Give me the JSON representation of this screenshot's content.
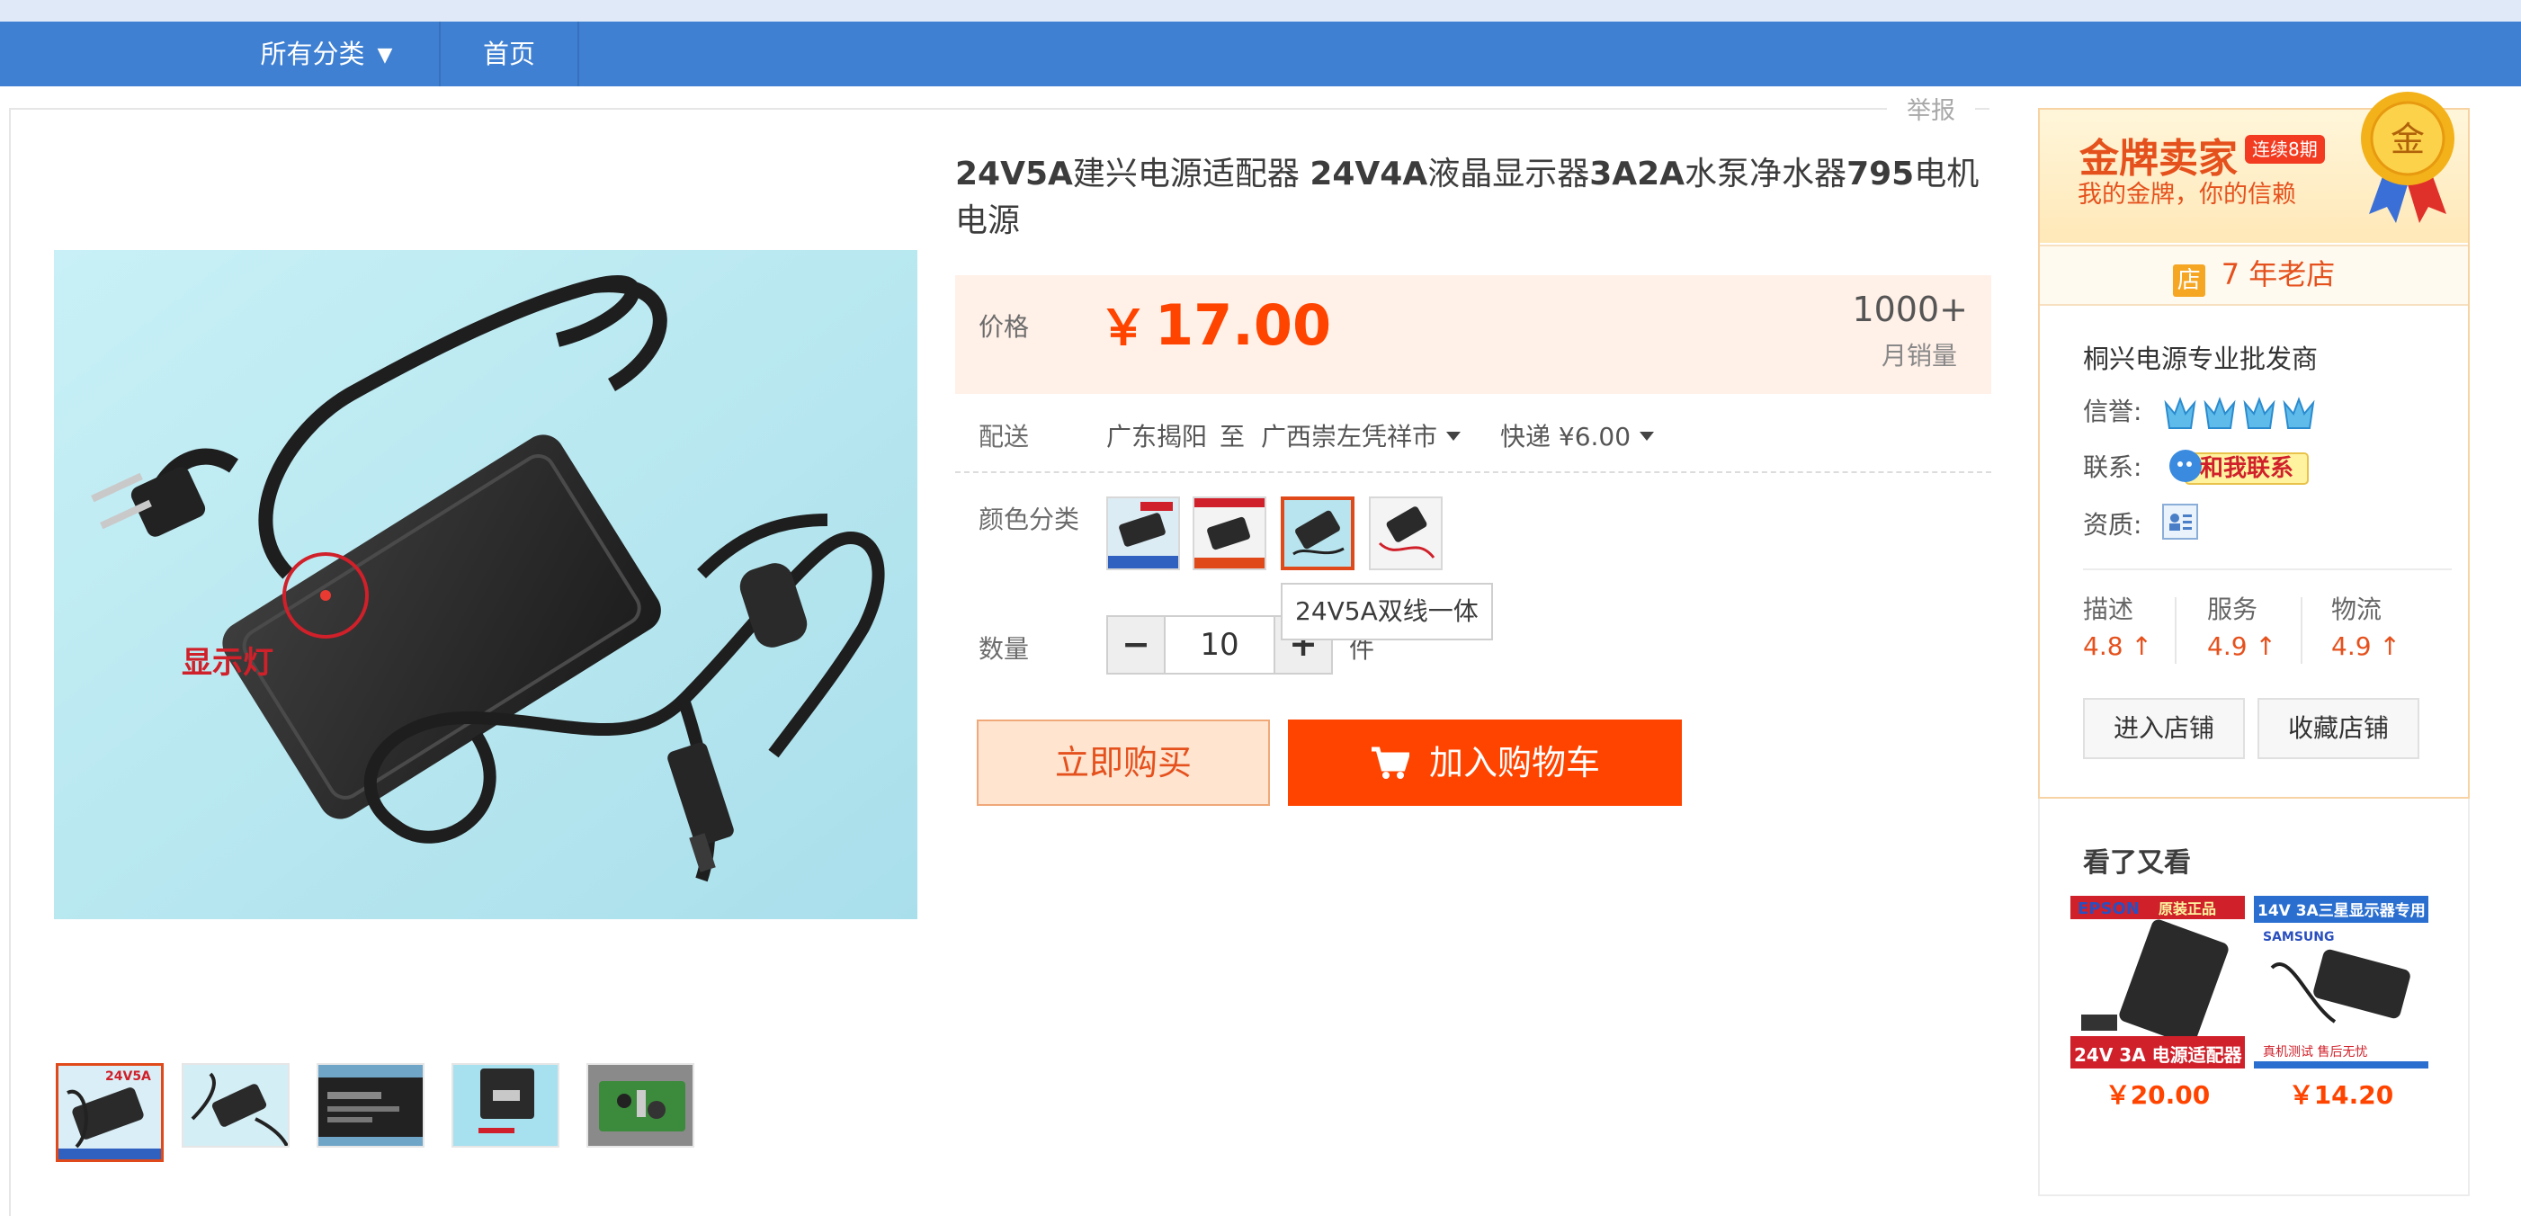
{
  "nav": {
    "all_categories": "所有分类",
    "home": "首页"
  },
  "report_label": "举报",
  "product": {
    "title_parts": [
      "24V5A",
      "建兴电源适配器 ",
      "24V4A",
      "液晶显示器",
      "3A2A",
      "水泵净水器",
      "795",
      "电机电源"
    ],
    "price_label": "价格",
    "price_symbol": "￥",
    "price": "17.00",
    "sales_count": "1000+",
    "sales_label": "月销量",
    "delivery_label": "配送",
    "delivery_from": "广东揭阳",
    "delivery_to_word": "至",
    "delivery_to": "广西崇左凭祥市",
    "shipping": "快递 ¥6.00",
    "color_label": "颜色分类",
    "thumb_label_1": "24V5A",
    "image_annotation": "显示灯",
    "sku_tooltip": "24V5A双线一体",
    "quantity_label": "数量",
    "quantity": "10",
    "quantity_unit": "件",
    "buy_now": "立即购买",
    "add_to_cart": "加入购物车"
  },
  "shop": {
    "gold_title": "金牌卖家",
    "gold_badge": "连续8期",
    "gold_sub": "我的金牌，你的信赖",
    "medal_char": "金",
    "shop_icon_char": "店",
    "years": "7 年老店",
    "name": "桐兴电源专业批发商",
    "credit_label": "信誉:",
    "contact_label": "联系:",
    "contact_button": "和我联系",
    "qualification_label": "资质:",
    "scores": [
      {
        "label": "描述",
        "value": "4.8"
      },
      {
        "label": "服务",
        "value": "4.9"
      },
      {
        "label": "物流",
        "value": "4.9"
      }
    ],
    "enter_shop": "进入店铺",
    "favorite_shop": "收藏店铺"
  },
  "also_viewed": {
    "title": "看了又看",
    "items": [
      {
        "price": "￥20.00",
        "brand": "EPSON",
        "tag": "原装正品",
        "caption": "24V 3A 电源适配器"
      },
      {
        "price": "￥14.20",
        "brand": "SAMSUNG",
        "tag": "14V 3A三星显示器专用",
        "caption": "真机测试 售后无忧"
      }
    ]
  },
  "colors": {
    "nav_bg": "#3f80d2",
    "accent": "#ff4400",
    "price_bg": "#fff0e8"
  }
}
